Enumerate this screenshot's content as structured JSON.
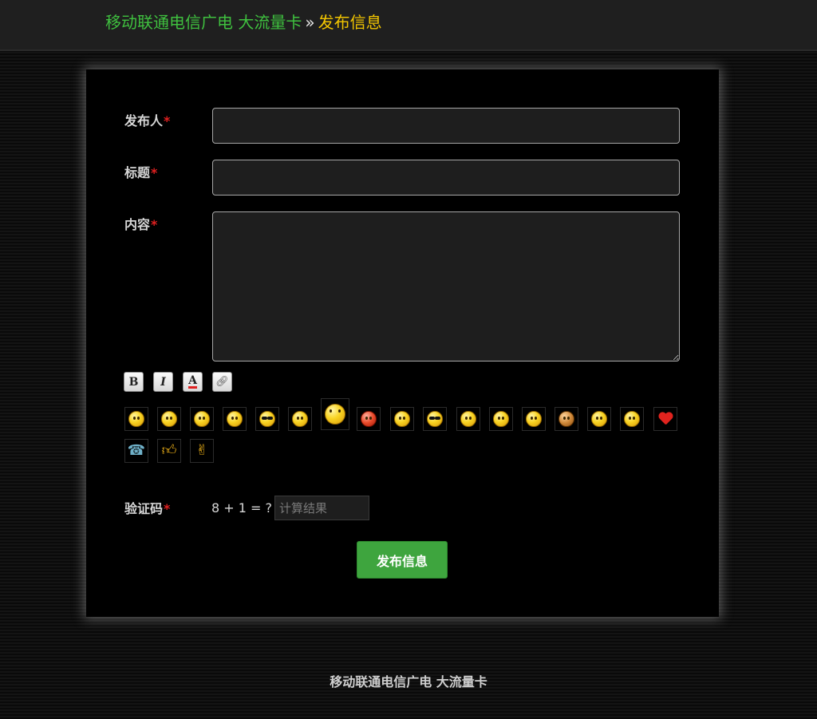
{
  "header": {
    "site_name": "移动联通电信广电 大流量卡",
    "separator": "»",
    "current_page": "发布信息"
  },
  "form": {
    "publisher": {
      "label": "发布人",
      "required_mark": "*",
      "value": ""
    },
    "title": {
      "label": "标题",
      "required_mark": "*",
      "value": ""
    },
    "content": {
      "label": "内容",
      "required_mark": "*",
      "value": ""
    },
    "toolbar": [
      {
        "name": "bold-button",
        "glyph": "B",
        "icon": "bold-icon"
      },
      {
        "name": "italic-button",
        "glyph": "I",
        "icon": "italic-icon"
      },
      {
        "name": "font-color-button",
        "glyph": "A",
        "icon": "font-color-icon"
      },
      {
        "name": "link-button",
        "glyph": "🔗",
        "icon": "link-icon"
      }
    ],
    "emoticons": [
      "smile-emoticon",
      "blush-emoticon",
      "tongue-emoticon",
      "surprised-emoticon",
      "cool-emoticon",
      "wink-emoticon",
      "crazy-emoticon",
      "angry-emoticon",
      "grin-emoticon",
      "sunglasses-emoticon",
      "shy-emoticon",
      "happy-emoticon",
      "shocked-emoticon",
      "bandage-emoticon",
      "eyepatch-emoticon",
      "cry-emoticon",
      "heart-emoticon",
      "phone-emoticon",
      "thumbs-up-emoticon",
      "peace-emoticon"
    ],
    "captcha": {
      "label": "验证码",
      "required_mark": "*",
      "question": "8 + 1 = ?",
      "placeholder": "计算结果",
      "value": ""
    },
    "submit_label": "发布信息"
  },
  "footer": {
    "text": "移动联通电信广电 大流量卡"
  },
  "colors": {
    "site_link": "#3fc03f",
    "current_page": "#f2c500",
    "required": "#e02020",
    "submit_bg": "#3ea53e"
  }
}
